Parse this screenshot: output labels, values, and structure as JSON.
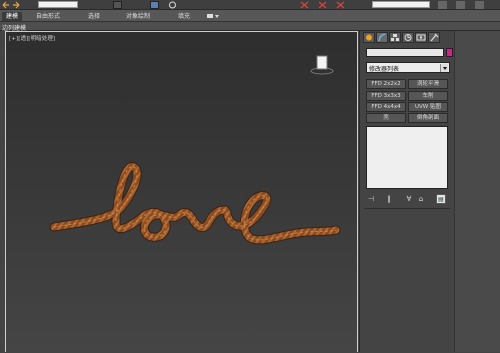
{
  "ribbon": {
    "tabs": [
      "建模",
      "自由形式",
      "选择",
      "对象绘制",
      "填充"
    ],
    "sub_label": "边列建模"
  },
  "viewport": {
    "label": "[+][透][明暗处理]",
    "text_shape": "love",
    "rope_color": "#8a4b22",
    "viewcube_icon": "viewcube-icon"
  },
  "command_panel": {
    "tabs": [
      "sun-icon",
      "modify-icon",
      "hierarchy-icon",
      "motion-icon",
      "display-icon",
      "utilities-icon"
    ],
    "color_swatch": "#c72a82",
    "modifier_list": "修改器列表",
    "modifier_buttons": [
      [
        "FFD 2x2x2",
        "涡轮平滑"
      ],
      [
        "FFD 3x3x3",
        "车削"
      ],
      [
        "FFD 4x4x4",
        "UVW 贴图"
      ],
      [
        "壳",
        "倒角剖面"
      ]
    ],
    "stack_tools": [
      "pin-stack-icon",
      "show-end-result-icon",
      "make-unique-icon",
      "remove-modifier-icon",
      "configure-modifier-sets-icon"
    ]
  }
}
